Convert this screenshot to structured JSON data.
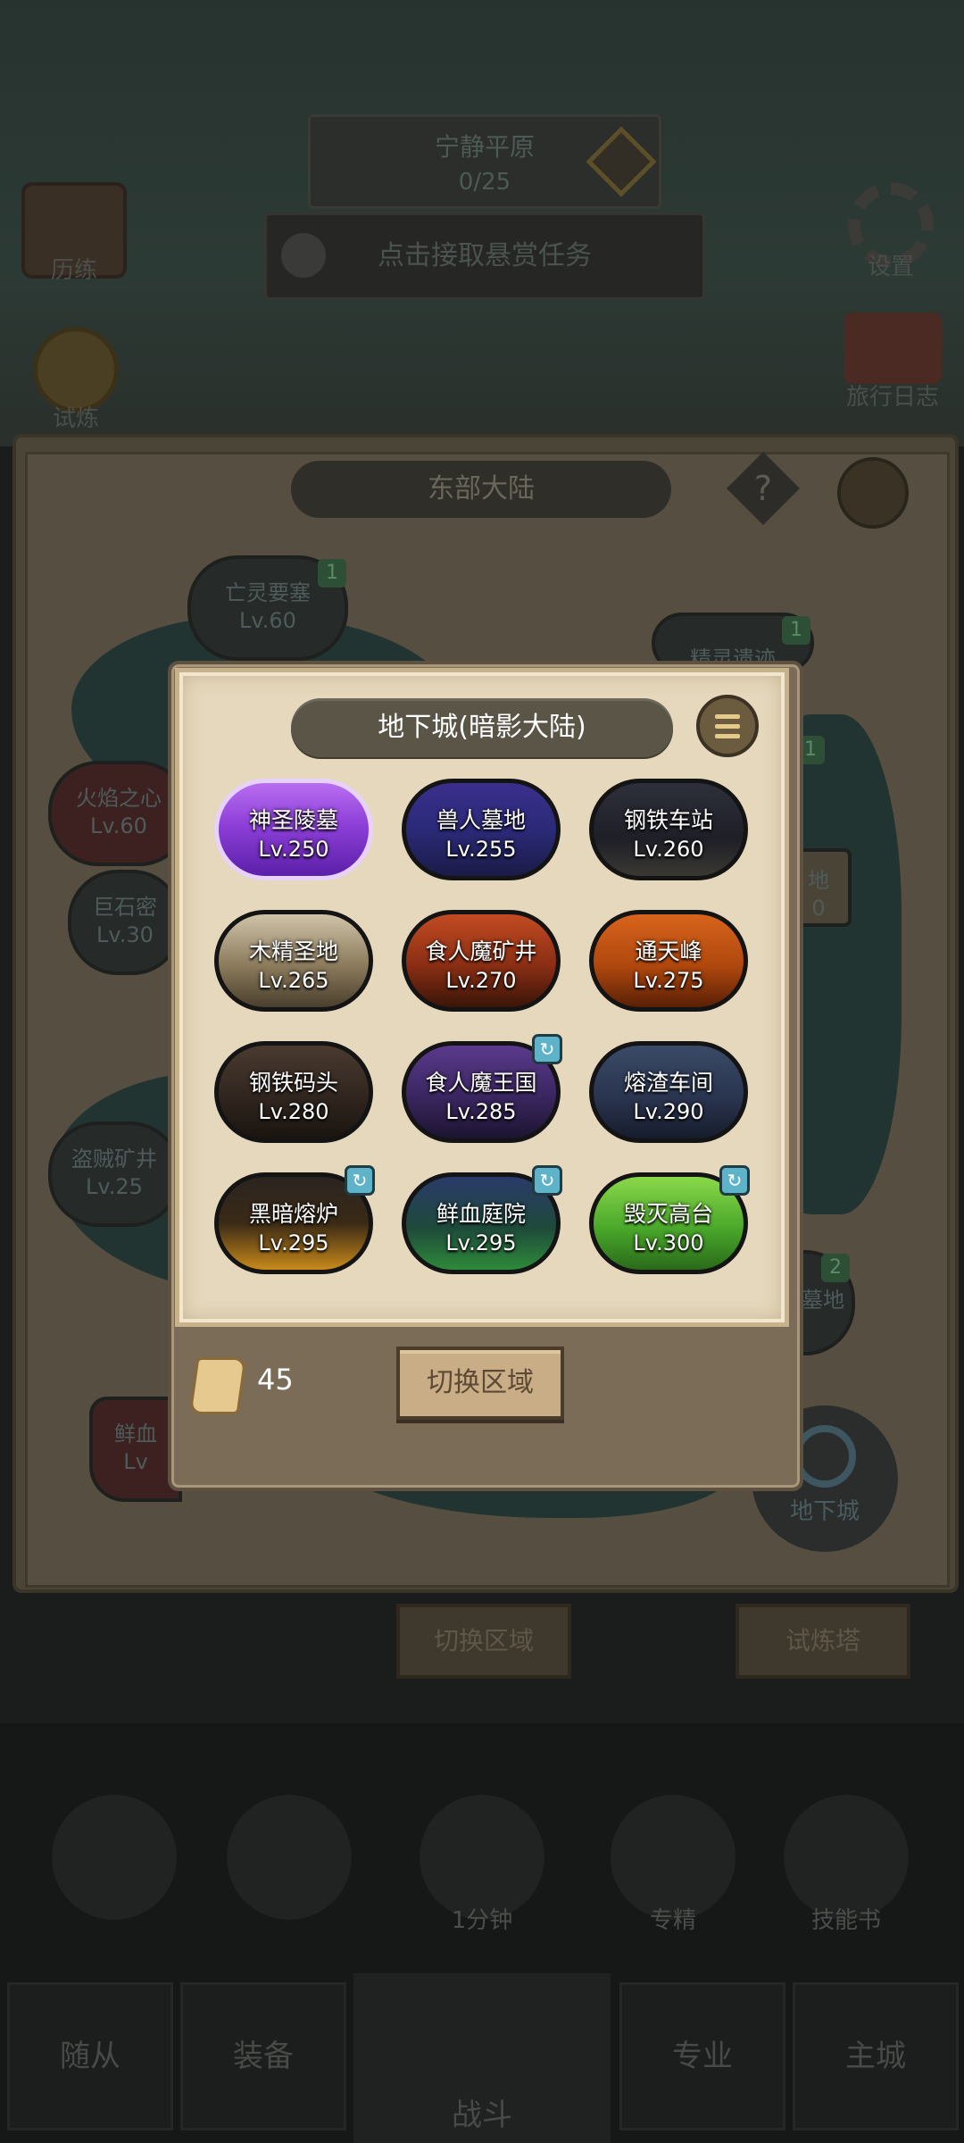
{
  "background": {
    "status": {
      "line1": "宁静平原",
      "line2": "0/25"
    },
    "bounty_text": "点击接取悬赏任务",
    "left_top_icon_label": "历练",
    "left_coin_label": "试炼",
    "settings_label": "设置",
    "log_label": "旅行日志",
    "map_title": "东部大陆",
    "help_symbol": "?",
    "map_nodes": [
      {
        "name": "亡灵要塞",
        "level": "Lv.60",
        "badge": "1"
      },
      {
        "name": "精灵遗迹",
        "level": "",
        "badge": "1"
      },
      {
        "name": "火焰之心",
        "level": "Lv.60"
      },
      {
        "name": "巨石密",
        "level": "Lv.30"
      },
      {
        "name": "盗贼矿井",
        "level": "Lv.25"
      },
      {
        "name": "鲜血",
        "level": "Lv"
      },
      {
        "name": "地",
        "level": "0",
        "badge": "1"
      },
      {
        "name": "墓地",
        "level": "",
        "badge": "2"
      }
    ],
    "dungeon_corner_label": "地下城",
    "map_switch_label": "切换区域",
    "trial_tower_label": "试炼塔",
    "skills": [
      {
        "label": ""
      },
      {
        "label": ""
      },
      {
        "label": "1分钟"
      },
      {
        "label": "专精"
      },
      {
        "label": "技能书"
      }
    ],
    "nav": [
      "随从",
      "装备",
      "战斗",
      "专业",
      "主城"
    ]
  },
  "popup": {
    "title": "地下城(暗影大陆)",
    "dungeons": [
      {
        "name": "神圣陵墓",
        "level": "Lv.250",
        "bg": "linear-gradient(180deg,#b86ef0 0%,#8d3fd8 45%,#5b1fa8 100%)",
        "border": "#e6d1ff",
        "badge": false
      },
      {
        "name": "兽人墓地",
        "level": "Lv.255",
        "bg": "linear-gradient(180deg,#3a2f8c 0%,#2b2a78 50%,#1b1b48 100%)",
        "border": "#141414",
        "badge": false
      },
      {
        "name": "钢铁车站",
        "level": "Lv.260",
        "bg": "linear-gradient(180deg,#2d2f3a 0%,#1e1f27 60%,#3a3832 100%)",
        "border": "#141414",
        "badge": false
      },
      {
        "name": "木精圣地",
        "level": "Lv.265",
        "bg": "linear-gradient(180deg,#cfc3a8 0%,#8c7b5c 55%,#4a3f2e 100%)",
        "border": "#141414",
        "badge": false
      },
      {
        "name": "食人魔矿井",
        "level": "Lv.270",
        "bg": "linear-gradient(180deg,#c24b22 0%,#8a2e14 55%,#3a1508 100%)",
        "border": "#141414",
        "badge": false
      },
      {
        "name": "通天峰",
        "level": "Lv.275",
        "bg": "linear-gradient(180deg,#d8641c 0%,#b0480e 55%,#5a2006 100%)",
        "border": "#141414",
        "badge": false
      },
      {
        "name": "钢铁码头",
        "level": "Lv.280",
        "bg": "linear-gradient(180deg,#4a3a30 0%,#2e241d 60%,#1a1410 100%)",
        "border": "#141414",
        "badge": false
      },
      {
        "name": "食人魔王国",
        "level": "Lv.285",
        "bg": "linear-gradient(180deg,#5a3a8c 0%,#3a2660 55%,#1c1430 100%)",
        "border": "#141414",
        "badge": true
      },
      {
        "name": "熔渣车间",
        "level": "Lv.290",
        "bg": "linear-gradient(180deg,#3a4a66 0%,#2a3550 55%,#161c2c 100%)",
        "border": "#141414",
        "badge": false
      },
      {
        "name": "黑暗熔炉",
        "level": "Lv.295",
        "bg": "linear-gradient(180deg,#2a2420 0%,#3a2a16 50%,#c98a1a 100%)",
        "border": "#141414",
        "badge": true
      },
      {
        "name": "鲜血庭院",
        "level": "Lv.295",
        "bg": "linear-gradient(180deg,#2a3a6a 0%,#1e4a3a 55%,#2e8a3a 100%)",
        "border": "#141414",
        "badge": true
      },
      {
        "name": "毁灭高台",
        "level": "Lv.300",
        "bg": "linear-gradient(180deg,#8ad84a 0%,#4aa82a 55%,#2a6a1a 100%)",
        "border": "#141414",
        "badge": true
      }
    ],
    "scroll_count": "45",
    "switch_label": "切换区域"
  },
  "colors": {
    "accent_badge": "#5fb3c8",
    "title_bar": "#5b5547",
    "paper": "#e6d8bc"
  }
}
